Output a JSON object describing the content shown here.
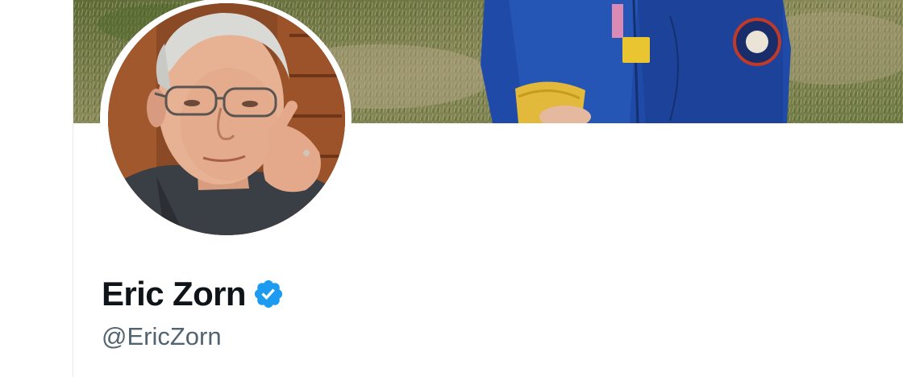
{
  "profile": {
    "display_name": "Eric Zorn",
    "handle": "@EricZorn",
    "verified": true,
    "verified_icon": "verified-badge-icon",
    "verified_color": "#1d9bf0"
  },
  "colors": {
    "name_text": "#0f1419",
    "handle_text": "#536471",
    "background": "#ffffff",
    "column_border": "#e8ecef"
  }
}
